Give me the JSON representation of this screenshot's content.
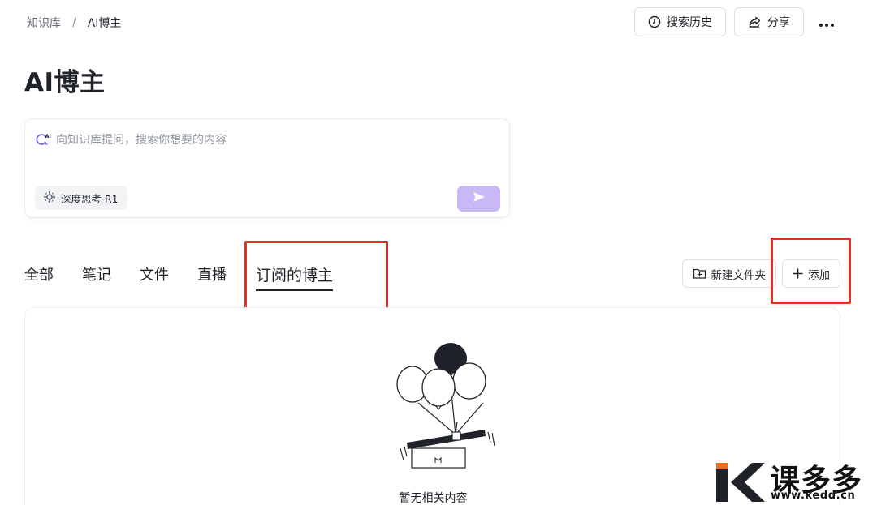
{
  "breadcrumb": {
    "root": "知识库",
    "separator": "/",
    "current": "AI博主"
  },
  "header": {
    "search_history": "搜索历史",
    "share": "分享",
    "more": "•••"
  },
  "page": {
    "title": "AI博主"
  },
  "ask": {
    "placeholder": "向知识库提问，搜索你想要的内容",
    "deep_think": "深度思考·R1",
    "send_color": "#c8b8f5"
  },
  "tabs": [
    {
      "label": "全部"
    },
    {
      "label": "笔记"
    },
    {
      "label": "文件"
    },
    {
      "label": "直播"
    },
    {
      "label": "订阅的博主",
      "active": true
    }
  ],
  "actions": {
    "new_folder": "新建文件夹",
    "add": "添加"
  },
  "empty_state": {
    "text": "暂无相关内容",
    "icon": "balloons-box-icon"
  },
  "highlight_color": "#e0302a",
  "watermark": {
    "brand": "课多多",
    "url": "www.kedd.cn",
    "logo_color": "#f26b1d"
  }
}
